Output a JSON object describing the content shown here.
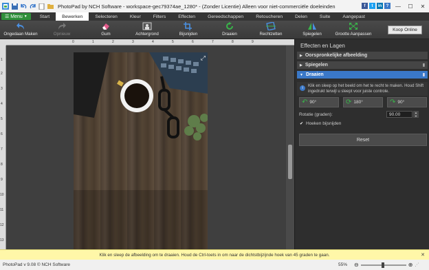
{
  "title": "PhotoPad by NCH Software - workspace-gec79374ae_1280* - (Zonder Licentie) Alleen voor niet-commerciële doeleinden",
  "menu_label": "Menu",
  "tabs": [
    "Start",
    "Bewerken",
    "Selecteren",
    "Kleur",
    "Filters",
    "Effecten",
    "Gereedschappen",
    "Retoucheren",
    "Delen",
    "Suite",
    "Aangepast"
  ],
  "active_tab": "Bewerken",
  "toolbar": {
    "undo": "Ongedaan Maken",
    "redo": "Opnieuw",
    "eraser": "Gum",
    "background": "Achtergrond",
    "crop": "Bijsnijden",
    "rotate": "Draaien",
    "straighten": "Rechtzetten",
    "mirror": "Spiegelen",
    "resize": "Grootte Aanpassen",
    "buy": "Koop Online"
  },
  "ruler": {
    "h_ticks": [
      "0",
      "1",
      "2",
      "3",
      "4",
      "5",
      "6",
      "7",
      "8",
      "9"
    ],
    "v_ticks": [
      "1",
      "2",
      "3",
      "4",
      "5",
      "6",
      "7",
      "8",
      "9",
      "10",
      "11",
      "12",
      "13"
    ]
  },
  "panel": {
    "title": "Effecten en Lagen",
    "sections": [
      "Oorspronkelijke afbeelding",
      "Spiegelen",
      "Draaien"
    ],
    "info": "Klik en sleep op het beeld om het te recht te maken. Houd Shift ingedrukt terwijl u sleept voor juiste controle.",
    "rot_buttons": [
      "90°",
      "180°",
      "90°"
    ],
    "rotation_label": "Rotatie (graden):",
    "rotation_value": "90.00",
    "crop_corners": "Hoeken bijsnijden",
    "reset": "Reset"
  },
  "hint": "Klik en sleep de afbeelding om te draaien. Houd de Ctrl-toets in om naar de dichtstbijzijnde hoek van 45 graden te gaan.",
  "status": {
    "version": "PhotoPad v 9.08 © NCH Software",
    "zoom": "55%"
  },
  "colors": {
    "accent": "#3a78c8",
    "menu": "#2f8f3a",
    "hint_bg": "#fff7a8"
  }
}
